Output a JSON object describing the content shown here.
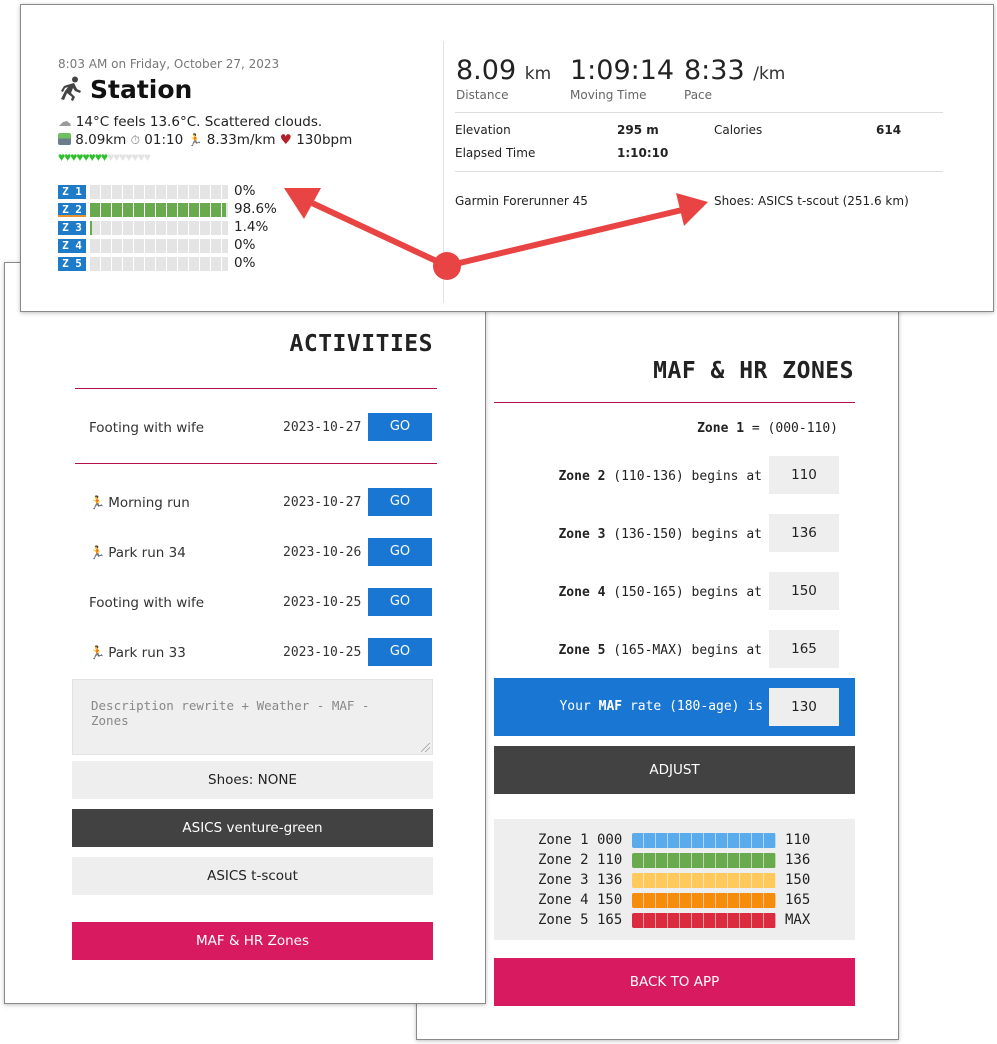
{
  "activity": {
    "datetime": "8:03 AM on Friday, October 27, 2023",
    "title": "Station",
    "weather": "14°C feels 13.6°C. Scattered clouds.",
    "distance_short": "8.09km",
    "time_short": "01:10",
    "pace_short": "8.33m/km",
    "heart_rate": "130bpm",
    "hearts_total": 15,
    "hearts_filled": 8,
    "hr_zones": [
      {
        "label": "Z 1",
        "pct_text": "0%",
        "fraction": 0.0
      },
      {
        "label": "Z 2",
        "pct_text": "98.6%",
        "fraction": 0.986
      },
      {
        "label": "Z 3",
        "pct_text": "1.4%",
        "fraction": 0.014
      },
      {
        "label": "Z 4",
        "pct_text": "0%",
        "fraction": 0.0
      },
      {
        "label": "Z 5",
        "pct_text": "0%",
        "fraction": 0.0
      }
    ],
    "stats": {
      "distance": {
        "value": "8.09",
        "unit": "km",
        "label": "Distance"
      },
      "moving_time": {
        "value": "1:09:14",
        "label": "Moving Time"
      },
      "pace": {
        "value": "8:33",
        "unit": "/km",
        "label": "Pace"
      }
    },
    "details": {
      "elevation_label": "Elevation",
      "elevation_value": "295 m",
      "calories_label": "Calories",
      "calories_value": "614",
      "elapsed_label": "Elapsed Time",
      "elapsed_value": "1:10:10"
    },
    "device": "Garmin Forerunner 45",
    "shoes": "Shoes: ASICS t-scout (251.6 km)"
  },
  "activities_panel": {
    "title": "ACTIVITIES",
    "go_label": "GO",
    "items": [
      {
        "name": "Footing with wife",
        "date": "2023-10-27",
        "runner": false
      },
      {
        "name": "Morning run",
        "date": "2023-10-27",
        "runner": true
      },
      {
        "name": "Park run 34",
        "date": "2023-10-26",
        "runner": true
      },
      {
        "name": "Footing with wife",
        "date": "2023-10-25",
        "runner": false
      },
      {
        "name": "Park run 33",
        "date": "2023-10-25",
        "runner": true
      }
    ],
    "description_placeholder": "Description rewrite + Weather - MAF - Zones",
    "shoe_options": [
      "Shoes: NONE",
      "ASICS venture-green",
      "ASICS t-scout"
    ],
    "maf_button": "MAF & HR Zones"
  },
  "maf_panel": {
    "title": "MAF & HR ZONES",
    "zone1_name": "Zone 1",
    "zone1_range": "= (000-110)",
    "zone_inputs": [
      {
        "name": "Zone 2",
        "range": "(110-136) begins at",
        "value": "110"
      },
      {
        "name": "Zone 3",
        "range": "(136-150) begins at",
        "value": "136"
      },
      {
        "name": "Zone 4",
        "range": "(150-165) begins at",
        "value": "150"
      },
      {
        "name": "Zone 5",
        "range": "(165-MAX) begins at",
        "value": "165"
      }
    ],
    "maf_prefix": "Your",
    "maf_word": "MAF",
    "maf_suffix": "rate (180-age) is",
    "maf_value": "130",
    "adjust_label": "ADJUST",
    "zone_chart": [
      {
        "label": "Zone 1 000",
        "end": "110",
        "color": "#5aabec"
      },
      {
        "label": "Zone 2 110",
        "end": "136",
        "color": "#6aaa4f"
      },
      {
        "label": "Zone 3 136",
        "end": "150",
        "color": "#ffc95c"
      },
      {
        "label": "Zone 4 150",
        "end": "165",
        "color": "#f58c0b"
      },
      {
        "label": "Zone 5 165",
        "end": "MAX",
        "color": "#db2b3f"
      }
    ],
    "back_label": "BACK TO APP"
  },
  "colors": {
    "primary_blue": "#1976d2",
    "pink": "#d81b60",
    "dark": "#424242",
    "arrow_red": "#e84444"
  }
}
